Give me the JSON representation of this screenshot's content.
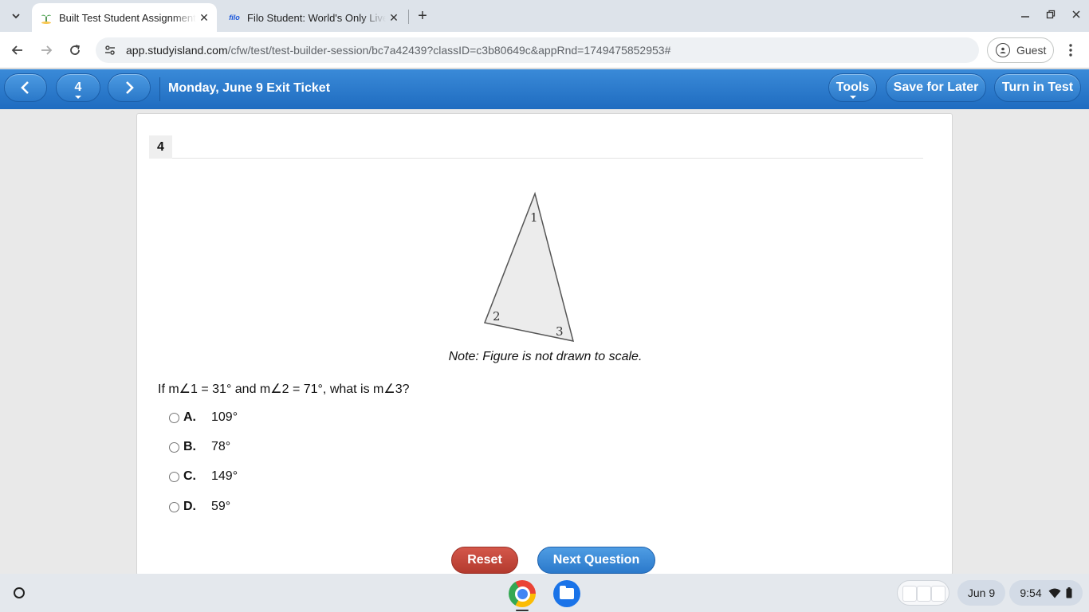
{
  "browser": {
    "tabs": [
      {
        "title": "Built Test Student Assignment",
        "favicon": "studyisland-icon",
        "active": true
      },
      {
        "title": "Filo Student: World's Only Live Instant Tutoring",
        "favicon_text": "filo",
        "active": false
      }
    ],
    "url_host": "app.studyisland.com",
    "url_path": "/cfw/test/test-builder-session/bc7a42439?classID=c3b80649c&appRnd=1749475852953#",
    "profile_label": "Guest"
  },
  "header": {
    "question_selector": "4",
    "title": "Monday, June 9 Exit Ticket",
    "tools_label": "Tools",
    "save_label": "Save for Later",
    "turnin_label": "Turn in Test",
    "accent_color": "#2a78c9"
  },
  "question": {
    "number": "4",
    "figure": {
      "vertex_labels": [
        "1",
        "2",
        "3"
      ]
    },
    "note": "Note: Figure is not drawn to scale.",
    "prompt": "If m∠1 = 31° and m∠2 = 71°, what is m∠3?",
    "choices": [
      {
        "letter": "A.",
        "text": "109°"
      },
      {
        "letter": "B.",
        "text": "78°"
      },
      {
        "letter": "C.",
        "text": "149°"
      },
      {
        "letter": "D.",
        "text": "59°"
      }
    ],
    "reset_label": "Reset",
    "next_label": "Next Question",
    "reset_color": "#c0463a",
    "next_color": "#2f7fd0"
  },
  "shelf": {
    "date": "Jun 9",
    "time": "9:54"
  }
}
